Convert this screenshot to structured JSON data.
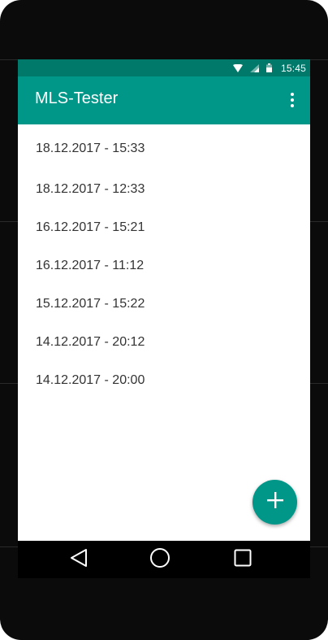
{
  "status_bar": {
    "time": "15:45",
    "icons": [
      "wifi-icon",
      "cell-signal-icon",
      "battery-icon"
    ]
  },
  "app_bar": {
    "title": "MLS-Tester",
    "menu_icon": "overflow-menu-icon"
  },
  "list": {
    "items": [
      "18.12.2017 - 15:33",
      "18.12.2017 - 12:33",
      "16.12.2017 - 15:21",
      "16.12.2017 - 11:12",
      "15.12.2017 - 15:22",
      "14.12.2017 - 20:12",
      "14.12.2017 - 20:00"
    ]
  },
  "fab": {
    "icon": "plus-icon"
  },
  "nav_bar": {
    "icons": [
      "back-icon",
      "home-icon",
      "recents-icon"
    ]
  },
  "colors": {
    "primary": "#009688",
    "primary_dark": "#00796b",
    "text": "#333333",
    "background": "#ffffff"
  }
}
